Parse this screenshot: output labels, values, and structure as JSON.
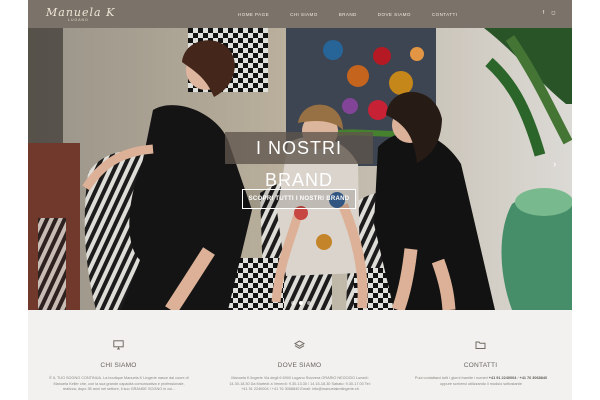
{
  "header": {
    "logo": "Manuela K",
    "logo_sub": "LUGANO",
    "nav": [
      "HOME PAGE",
      "CHI SIAMO",
      "BRAND",
      "DOVE SIAMO",
      "CONTATTI"
    ],
    "social_icons": [
      "facebook-icon",
      "instagram-icon"
    ],
    "colors": {
      "bar": "#7b7369"
    }
  },
  "hero": {
    "title": "I NOSTRI BRAND",
    "button_label": "SCOPRI TUTTI I NOSTRI BRAND",
    "slides": 3,
    "active_slide": 1
  },
  "features": [
    {
      "icon": "monitor-icon",
      "title": "CHI SIAMO",
      "text": "È IL TUO SOGNO CONTINUA. La boutique Manuela K Lingerie nasce dal cuore di Manuela Keller che, con la sua grande capacità comunicativa e professionale, realizza, dopo 35 anni nel settore, il suo GRANDE SOGNO in cui..."
    },
    {
      "icon": "layers-icon",
      "title": "DOVE SIAMO",
      "text": "Manuela K lingerie Via degli 6 6900 Lugano Svizzera ORARIO NEGOZIO Lunedì: 14.30-18.30 Da Martedì a Venerdì: 9.30-13.30 / 14.15-18.30 Sabato: 9.30-17.00 Tel: +41 91 2240004 / +41 76 3068840 Email: info@manuelakmlingerie.ch"
    },
    {
      "icon": "folder-icon",
      "title": "CONTATTI",
      "text_before": "Puoi contattarci tutti i giorni tramite i numeri",
      "phone_1": "+41 91 2240004",
      "separator": "/",
      "phone_2": "+41 76 3068840",
      "text_after": "oppure scriverci utilizzando il modulo sottostante"
    }
  ]
}
